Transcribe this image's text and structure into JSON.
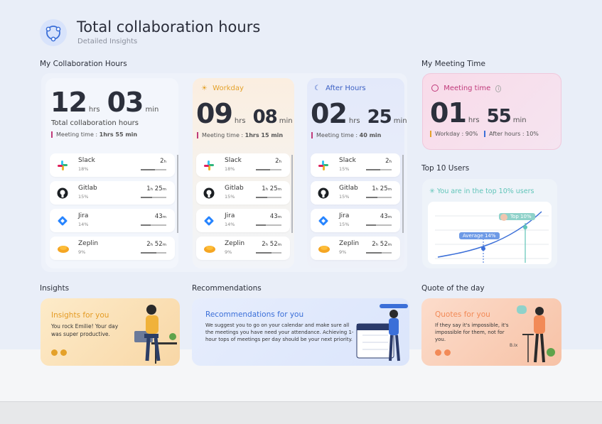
{
  "header": {
    "title": "Total collaboration hours",
    "subtitle": "Detailed Insights"
  },
  "sections": {
    "collab": "My Collaboration Hours",
    "meeting": "My Meeting Time",
    "top_users": "Top 10 Users",
    "insights": "Insights",
    "recommendations": "Recommendations",
    "quote": "Quote of the day"
  },
  "total": {
    "hours": "12",
    "hrs": "hrs",
    "mins": "03",
    "min": "min",
    "label": "Total collaboration hours",
    "meeting": "Meeting time :",
    "meeting_val": "1hrs 55 min",
    "apps": [
      {
        "name": "Slack",
        "pct": "18%",
        "time": "2",
        "unit": "h",
        "fill": 0.55
      },
      {
        "name": "Gitlab",
        "pct": "15%",
        "time": "1",
        "unit": "h",
        "time2": "25",
        "unit2": "m",
        "fill": 0.45
      },
      {
        "name": "Jira",
        "pct": "14%",
        "time": "43",
        "unit": "m",
        "fill": 0.4
      },
      {
        "name": "Zeplin",
        "pct": "9%",
        "time": "2",
        "unit": "h",
        "time2": "52",
        "unit2": "m",
        "fill": 0.6
      }
    ]
  },
  "workday": {
    "label": "Workday",
    "hours": "09",
    "hrs": "hrs",
    "mins": "08",
    "min": "min",
    "meeting": "Meeting time :",
    "meeting_val": "1hrs 15 min",
    "apps": [
      {
        "name": "Slack",
        "pct": "18%",
        "time": "2",
        "unit": "h",
        "fill": 0.55
      },
      {
        "name": "Gitlab",
        "pct": "15%",
        "time": "1",
        "unit": "h",
        "time2": "25",
        "unit2": "m",
        "fill": 0.45
      },
      {
        "name": "Jira",
        "pct": "14%",
        "time": "43",
        "unit": "m",
        "fill": 0.4
      },
      {
        "name": "Zeplin",
        "pct": "9%",
        "time": "2",
        "unit": "h",
        "time2": "52",
        "unit2": "m",
        "fill": 0.6
      }
    ]
  },
  "after": {
    "label": "After Hours",
    "hours": "02",
    "hrs": "hrs",
    "mins": "25",
    "min": "min",
    "meeting": "Meeting time :",
    "meeting_val": "40 min",
    "apps": [
      {
        "name": "Slack",
        "pct": "15%",
        "time": "2",
        "unit": "h",
        "fill": 0.55
      },
      {
        "name": "Gitlab",
        "pct": "15%",
        "time": "1",
        "unit": "h",
        "time2": "25",
        "unit2": "m",
        "fill": 0.45
      },
      {
        "name": "Jira",
        "pct": "15%",
        "time": "43",
        "unit": "m",
        "fill": 0.4
      },
      {
        "name": "Zeplin",
        "pct": "9%",
        "time": "2",
        "unit": "h",
        "time2": "52",
        "unit2": "m",
        "fill": 0.6
      }
    ]
  },
  "meeting_card": {
    "label": "Meeting time",
    "hours": "01",
    "hrs": "hrs",
    "mins": "55",
    "min": "min",
    "workday": "Workday : 90%",
    "afterhours": "After hours : 10%"
  },
  "top_card": {
    "text": "You are in the top 10% users",
    "avg": "Average 14%",
    "top": "Top 10%"
  },
  "insights_card": {
    "title": "Insights for you",
    "text": "You rock Emilie! Your day was super productive."
  },
  "rec_card": {
    "title": "Recommendations for you",
    "text": "We suggest you to go on your calendar and make sure all the meetings you have need your attendance. Achieving 1-hour tops of meetings per day should be your next priority."
  },
  "quote_card": {
    "title": "Quotes for you",
    "text": "If they say it's impossible, it's impossible for them, not for you.",
    "author": "B.Ix"
  },
  "colors": {
    "accent": "#3b6fd8",
    "workday": "#e4a12a",
    "after": "#3b5fc4",
    "meeting": "#c0397a",
    "teal": "#5fc4b8"
  }
}
